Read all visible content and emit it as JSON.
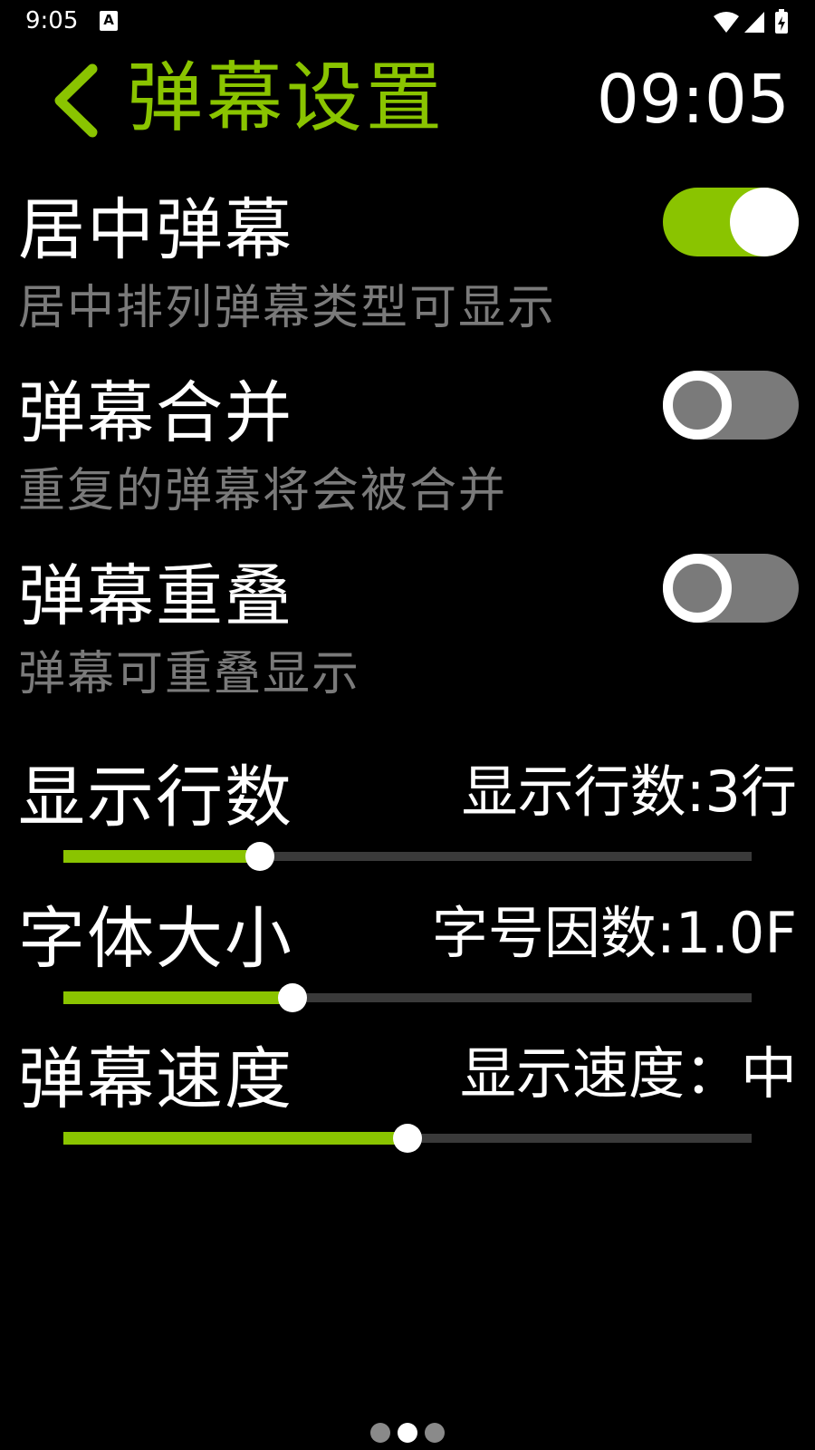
{
  "status_bar": {
    "time": "9:05",
    "notification_icon": "A",
    "icons": [
      "wifi-icon",
      "cell-signal-icon",
      "battery-charging-icon"
    ]
  },
  "header": {
    "title": "弹幕设置",
    "clock": "09:05",
    "accent_color": "#8ac400"
  },
  "toggles": [
    {
      "title": "居中弹幕",
      "subtitle": "居中排列弹幕类型可显示",
      "state": "on"
    },
    {
      "title": "弹幕合并",
      "subtitle": "重复的弹幕将会被合并",
      "state": "off"
    },
    {
      "title": "弹幕重叠",
      "subtitle": "弹幕可重叠显示",
      "state": "off"
    }
  ],
  "sliders": [
    {
      "title": "显示行数",
      "value_label": "显示行数:3行",
      "fraction": 0.285
    },
    {
      "title": "字体大小",
      "value_label": "字号因数:1.0F",
      "fraction": 0.333
    },
    {
      "title": "弹幕速度",
      "value_label": "显示速度：中",
      "fraction": 0.5
    }
  ],
  "pager": {
    "count": 3,
    "active_index": 1
  }
}
